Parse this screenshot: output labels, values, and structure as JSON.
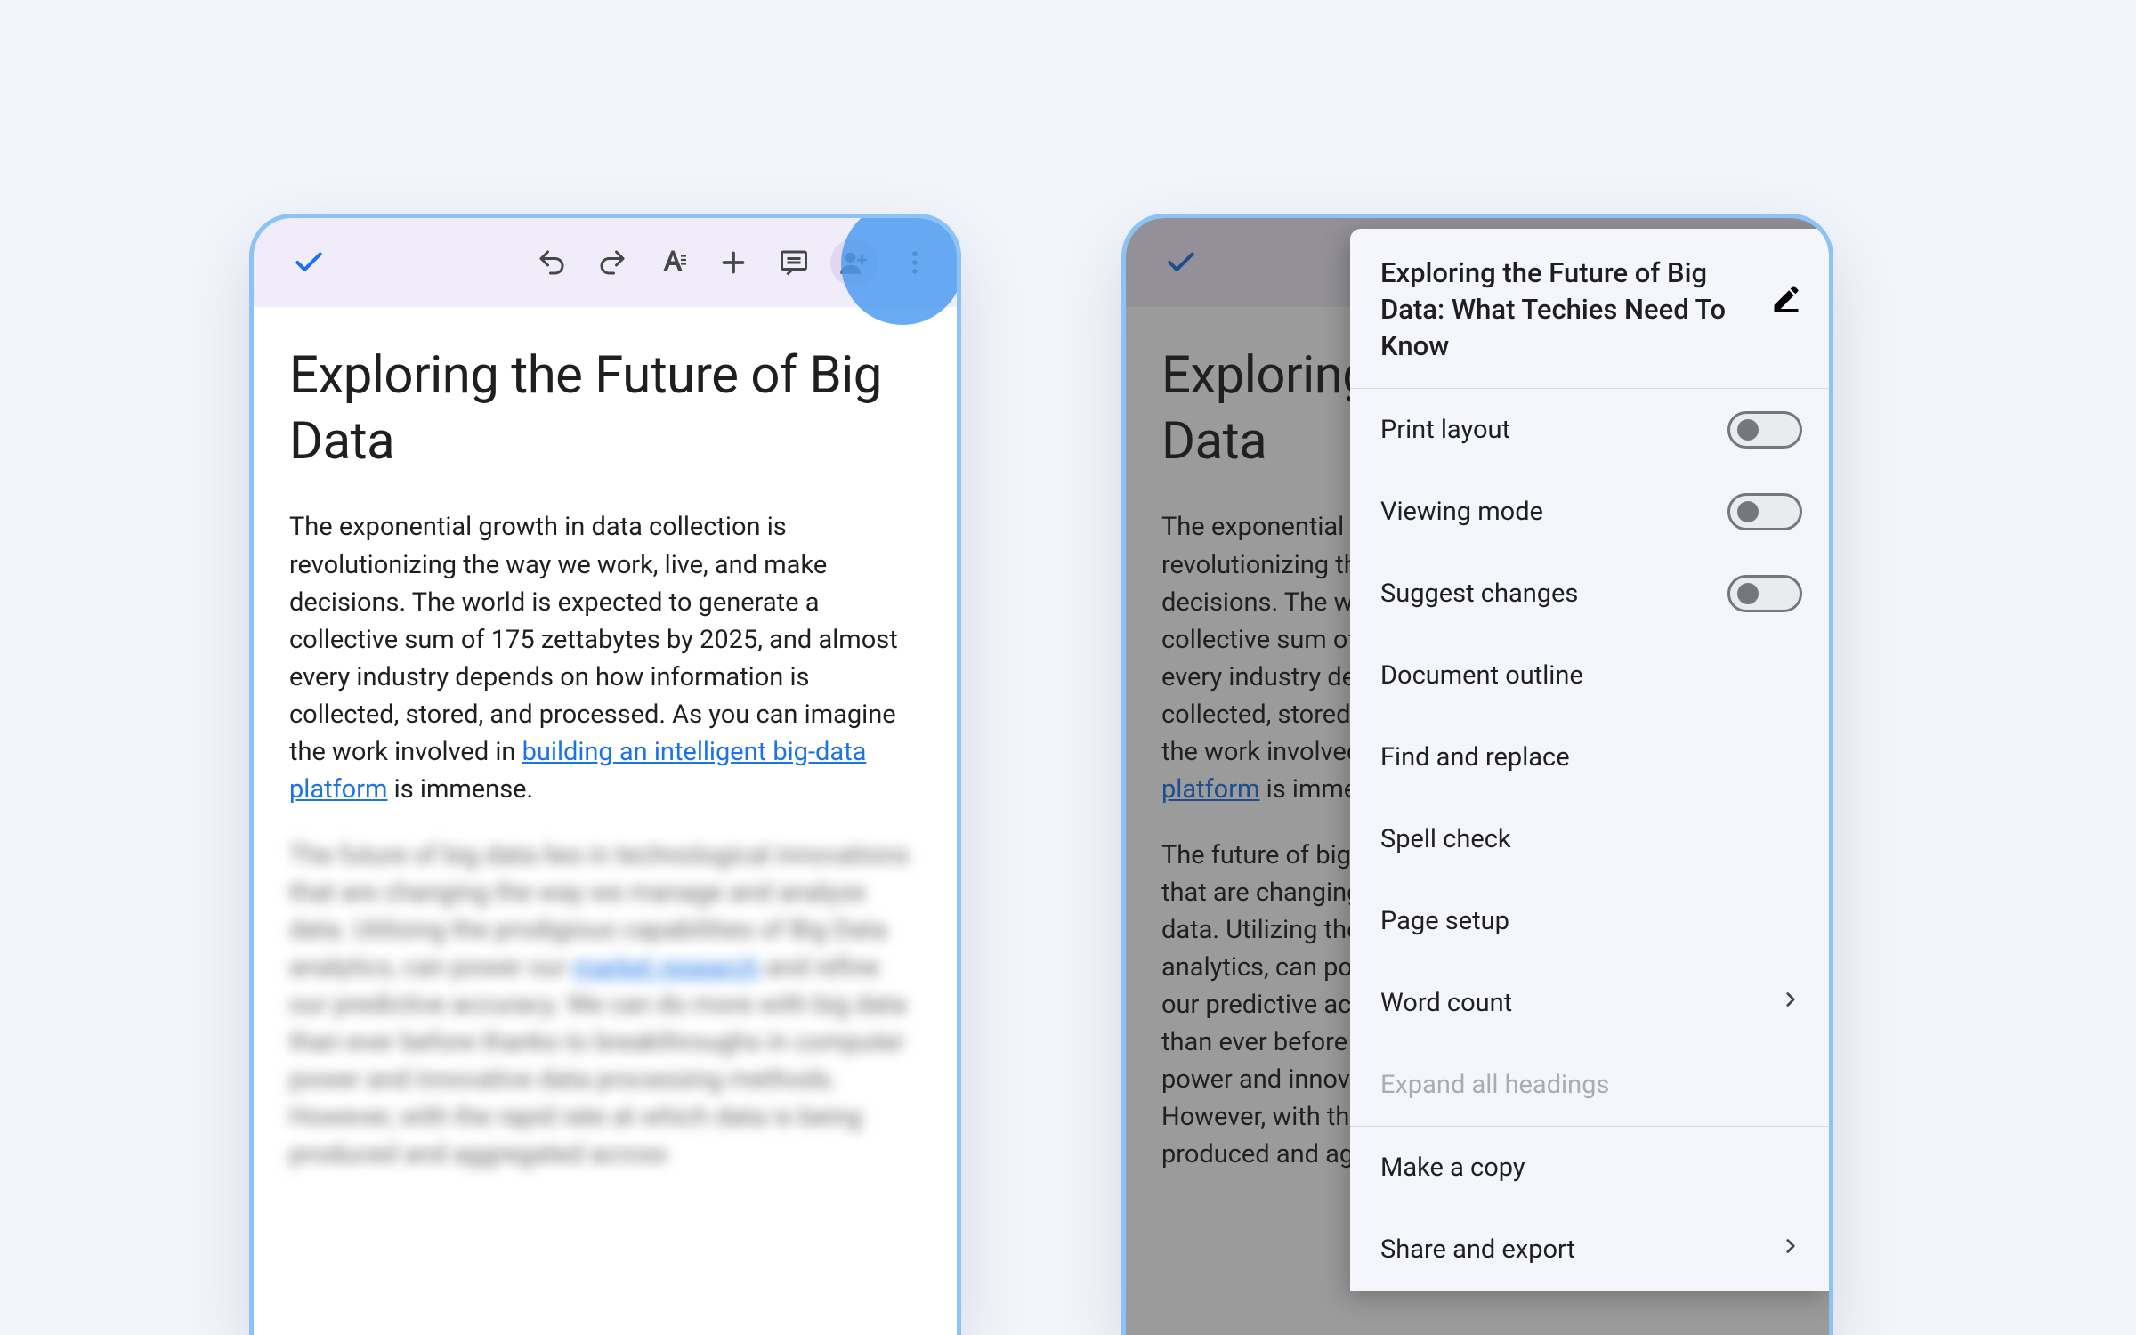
{
  "phone1": {
    "title": "Exploring the Future of Big Data",
    "para1_a": "The exponential growth in data collection is revolutionizing the way we work, live, and make decisions. The world is expected to generate a collective sum of 175 zettabytes by 2025, and almost every industry depends on how information is collected, stored, and processed. As you can imagine the work involved in ",
    "para1_link": "building an intelligent big-data platform",
    "para1_b": " is immense.",
    "para2_a": "The future of big data lies in technological innovations that are changing the way we manage and analyze data. Utilizing the prodigious capabilities of Big Data analytics, can power our ",
    "para2_link": "market research",
    "para2_b": " and refine our predictive accuracy. We can do more with big data than ever before thanks to breakthroughs in computer power and innovative data processing methods. However, with the rapid rate at which data is being produced and aggregated across"
  },
  "phone2": {
    "title": "Exploring the Future of Big Data",
    "para1_a": "The exponential growth in data collection is revolutionizing the way we work, live, and make decisions. The world is expected to generate a collective sum of 175 zettabytes by 2025, and almost every industry depends on how information is collected, stored, and processed. As you can imagine the work involved in ",
    "para1_link": "building an intelligent big-data platform",
    "para1_b": " is immense.",
    "para2_a": "The future of big data lies in technological innovations that are changing the way we manage and analyze data. Utilizing the prodigious capabilities of Big Data analytics, can power our ",
    "para2_link": "market research",
    "para2_b": " and refine our predictive accuracy. We can do more with big data than ever before thanks to breakthroughs in computer power and innovative data processing methods. However, with the rapid rate at which data is being produced and aggregated across"
  },
  "menu": {
    "title": "Exploring the Future of Big Data: What Techies Need To Know",
    "print_layout": "Print layout",
    "viewing_mode": "Viewing mode",
    "suggest_changes": "Suggest changes",
    "document_outline": "Document outline",
    "find_replace": "Find and replace",
    "spell_check": "Spell check",
    "page_setup": "Page setup",
    "word_count": "Word count",
    "expand_headings": "Expand all headings",
    "make_copy": "Make a copy",
    "share_export": "Share and export"
  }
}
